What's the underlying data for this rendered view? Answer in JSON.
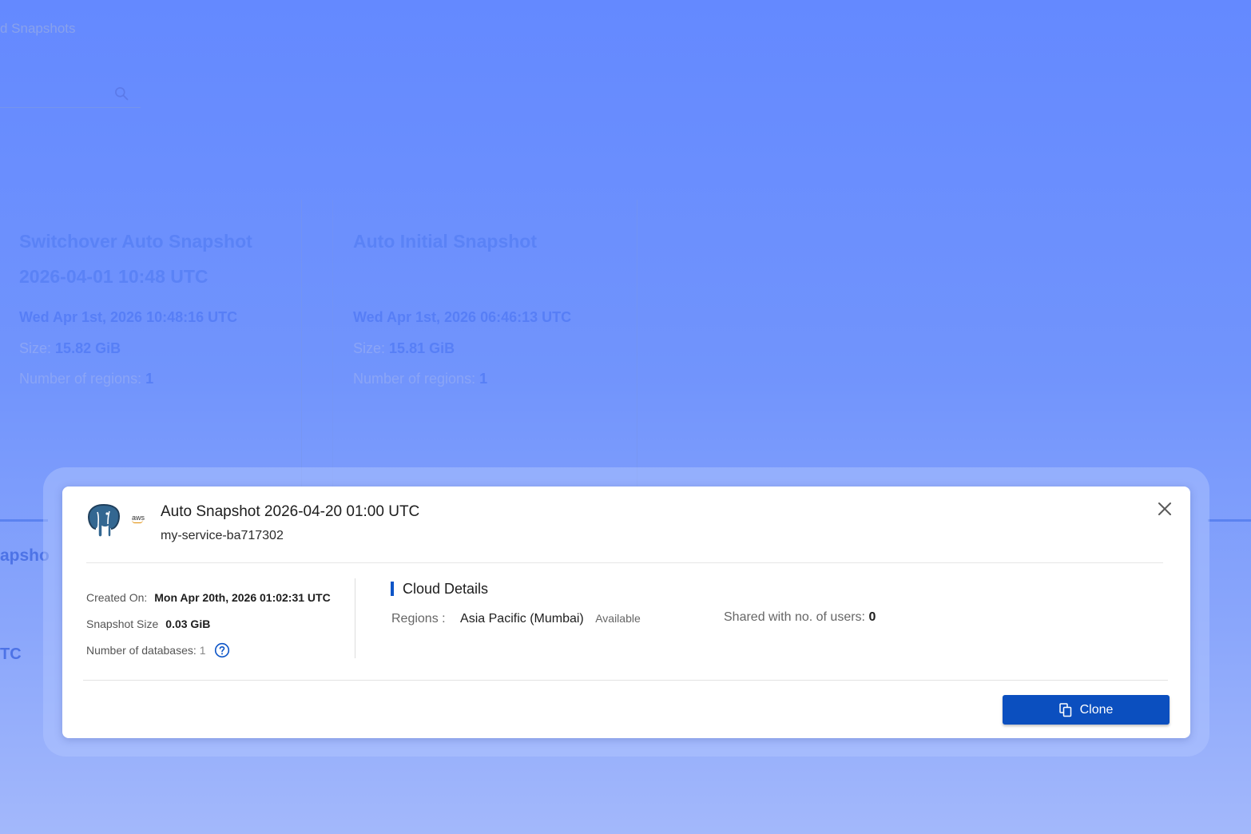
{
  "background": {
    "breadcrumb": "d Snapshots",
    "cards": [
      {
        "title": "Switchover Auto Snapshot 2026-04-01 10:48 UTC",
        "date": "Wed Apr 1st, 2026 10:48:16 UTC",
        "size_label": "Size:",
        "size_value": "15.82 GiB",
        "regions_label": "Number of regions:",
        "regions_value": "1"
      },
      {
        "title": "Auto Initial Snapshot",
        "date": "Wed Apr 1st, 2026 06:46:13 UTC",
        "size_label": "Size:",
        "size_value": "15.81 GiB",
        "regions_label": "Number of regions:",
        "regions_value": "1"
      }
    ],
    "lower_title_fragment": "apsho",
    "lower_tc_fragment": "TC"
  },
  "modal": {
    "logo_icon": "postgresql-elephant-icon",
    "provider_badge": "aws",
    "title": "Auto Snapshot 2026-04-20 01:00 UTC",
    "subtitle": "my-service-ba717302",
    "created_label": "Created On:",
    "created_value": "Mon Apr 20th, 2026 01:02:31 UTC",
    "size_label": "Snapshot Size",
    "size_value": "0.03 GiB",
    "databases_label": "Number of databases:",
    "databases_value": "1",
    "cloud_heading": "Cloud Details",
    "regions_label": "Regions :",
    "region_name": "Asia Pacific (Mumbai)",
    "region_status": "Available",
    "shared_label": "Shared with no. of users:",
    "shared_value": "0",
    "clone_label": "Clone"
  },
  "colors": {
    "overlay": "#6f8ffc",
    "primary_button": "#0b4fbf",
    "accent_bar": "#0d55c7"
  }
}
